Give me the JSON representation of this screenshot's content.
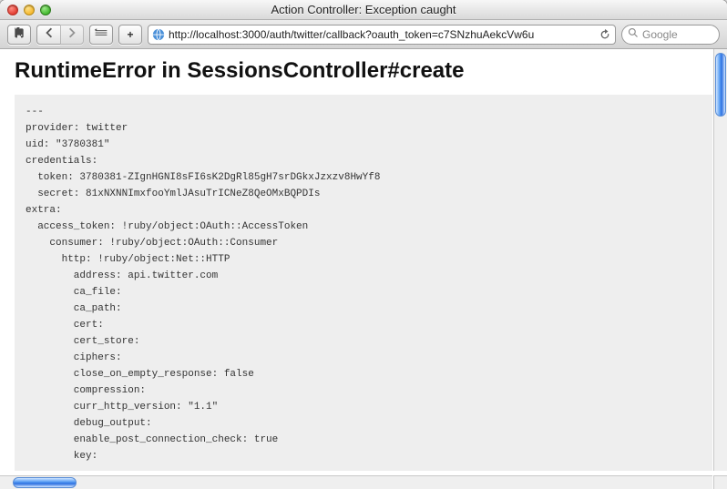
{
  "window": {
    "title": "Action Controller: Exception caught"
  },
  "toolbar": {
    "url": "http://localhost:3000/auth/twitter/callback?oauth_token=c7SNzhuAekcVw6u",
    "search_placeholder": "Google",
    "add_label": "+"
  },
  "page": {
    "heading": "RuntimeError in SessionsController#create",
    "lines": [
      "---",
      "provider: twitter",
      "uid: \"3780381\"",
      "credentials:",
      "  token: 3780381-ZIgnHGNI8sFI6sK2DgRl85gH7srDGkxJzxzv8HwYf8",
      "  secret: 81xNXNNImxfooYmlJAsuTrICNeZ8QeOMxBQPDIs",
      "extra:",
      "  access_token: !ruby/object:OAuth::AccessToken",
      "    consumer: !ruby/object:OAuth::Consumer",
      "      http: !ruby/object:Net::HTTP",
      "        address: api.twitter.com",
      "        ca_file:",
      "        ca_path:",
      "        cert:",
      "        cert_store:",
      "        ciphers:",
      "        close_on_empty_response: false",
      "        compression:",
      "        curr_http_version: \"1.1\"",
      "        debug_output:",
      "        enable_post_connection_check: true",
      "        key:"
    ]
  }
}
